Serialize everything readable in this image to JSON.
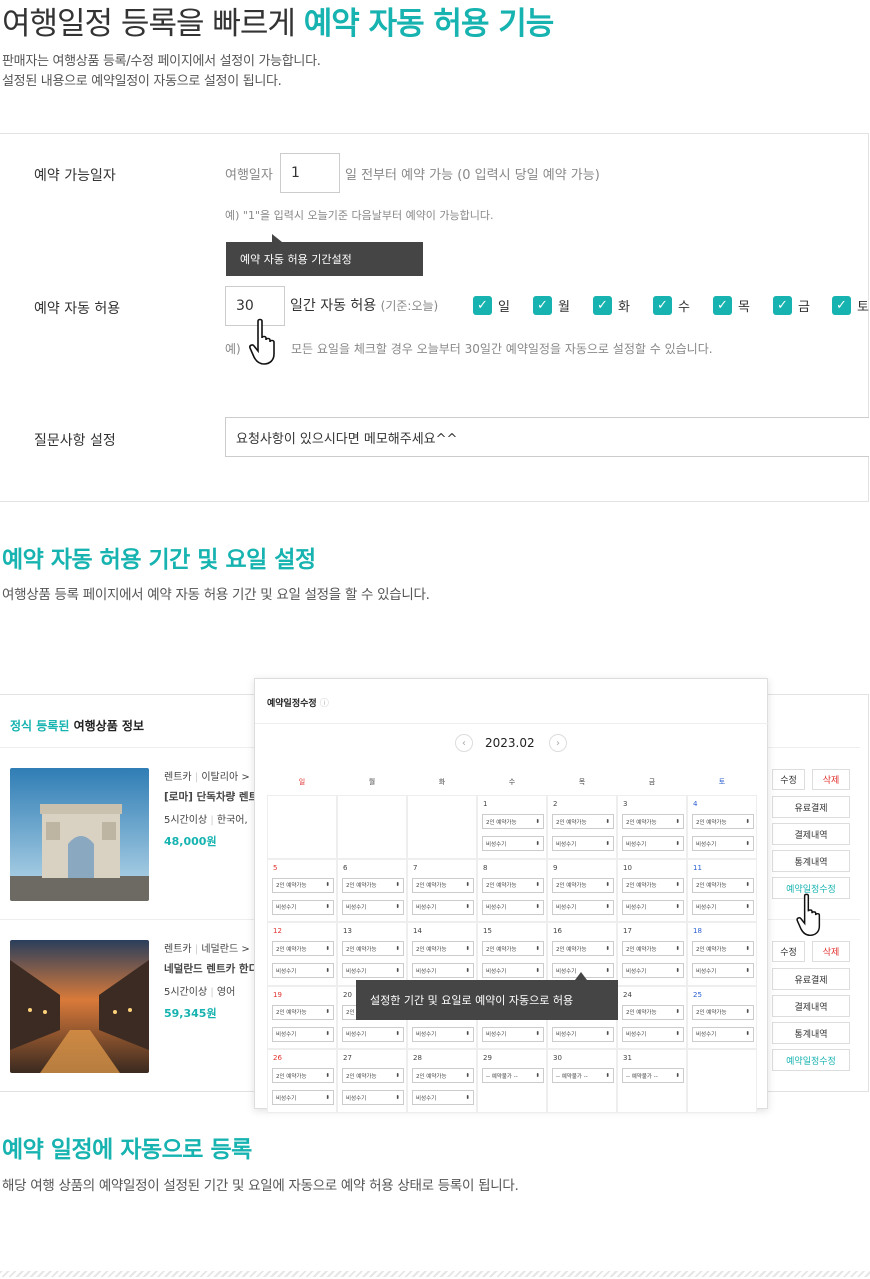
{
  "header": {
    "title_main": "여행일정 등록을 빠르게 ",
    "title_accent": "예약 자동 허용 기능",
    "desc_line1": "판매자는 여행상품 등록/수정 페이지에서 설정이 가능합니다.",
    "desc_line2": "설정된 내용으로 예약일정이 자동으로 설정이 됩니다."
  },
  "settings": {
    "available_label": "예약 가능일자",
    "available_prefix": "여행일자",
    "available_value": "1",
    "available_suffix": "일 전부터 예약 가능 (0 입력시 당일 예약 가능)",
    "available_note": "예) \"1\"을 입력시 오늘기준 다음날부터 예약이 가능합니다.",
    "tooltip": "예약 자동 허용 기간설정",
    "auto_label": "예약 자동 허용",
    "auto_value": "30",
    "auto_suffix": "일간 자동 허용",
    "auto_basis": "(기준:오늘)",
    "days": [
      "일",
      "월",
      "화",
      "수",
      "목",
      "금",
      "토"
    ],
    "auto_note_prefix": "예)",
    "auto_note": "모든 요일을 체크할 경우 오늘부터 30일간 예약일정을 자동으로 설정할 수 있습니다.",
    "question_label": "질문사항 설정",
    "question_value": "요청사항이 있으시다면 메모해주세요^^"
  },
  "section2": {
    "title": "예약 자동 허용 기간 및 요일 설정",
    "desc": "여행상품 등록 페이지에서 예약 자동 허용 기간 및 요일 설정을 할 수 있습니다."
  },
  "product_list": {
    "heading_accent": "정식 등록된",
    "heading_rest": " 여행상품 정보",
    "items": [
      {
        "cat": "렌트카",
        "region": "이탈리아 >",
        "name": "[로마] 단독차량 렌트",
        "duration": "5시간이상",
        "lang": "한국어,",
        "price": "48,000원"
      },
      {
        "cat": "렌트카",
        "region": "네덜란드 >",
        "name": "네덜란드 렌트카 한디",
        "duration": "5시간이상",
        "lang": "영어",
        "price": "59,345원"
      }
    ],
    "btn_edit": "수정",
    "btn_delete": "삭제",
    "btn_paid": "유료결제",
    "btn_payment": "결제내역",
    "btn_stats": "통계내역",
    "btn_schedule": "예약일정수정"
  },
  "calendar": {
    "title": "예약일정수정",
    "month": "2023.02",
    "weekdays": [
      "일",
      "월",
      "화",
      "수",
      "목",
      "금",
      "토"
    ],
    "opt_available": "2인 예약가능",
    "opt_unavailable": "-- 예약불가 --",
    "opt_private": "비성수기",
    "tooltip": "설정한 기간 및 요일로 예약이 자동으로 허용",
    "sunday_color": "#e0322f",
    "saturday_color": "#2a5fd1"
  },
  "section3": {
    "title": "예약 일정에 자동으로 등록",
    "desc": "해당 여행 상품의 예약일정이 설정된 기간 및 요일에 자동으로 예약 허용 상태로 등록이 됩니다."
  },
  "colors": {
    "accent": "#16b3b0",
    "danger": "#e0322f"
  }
}
